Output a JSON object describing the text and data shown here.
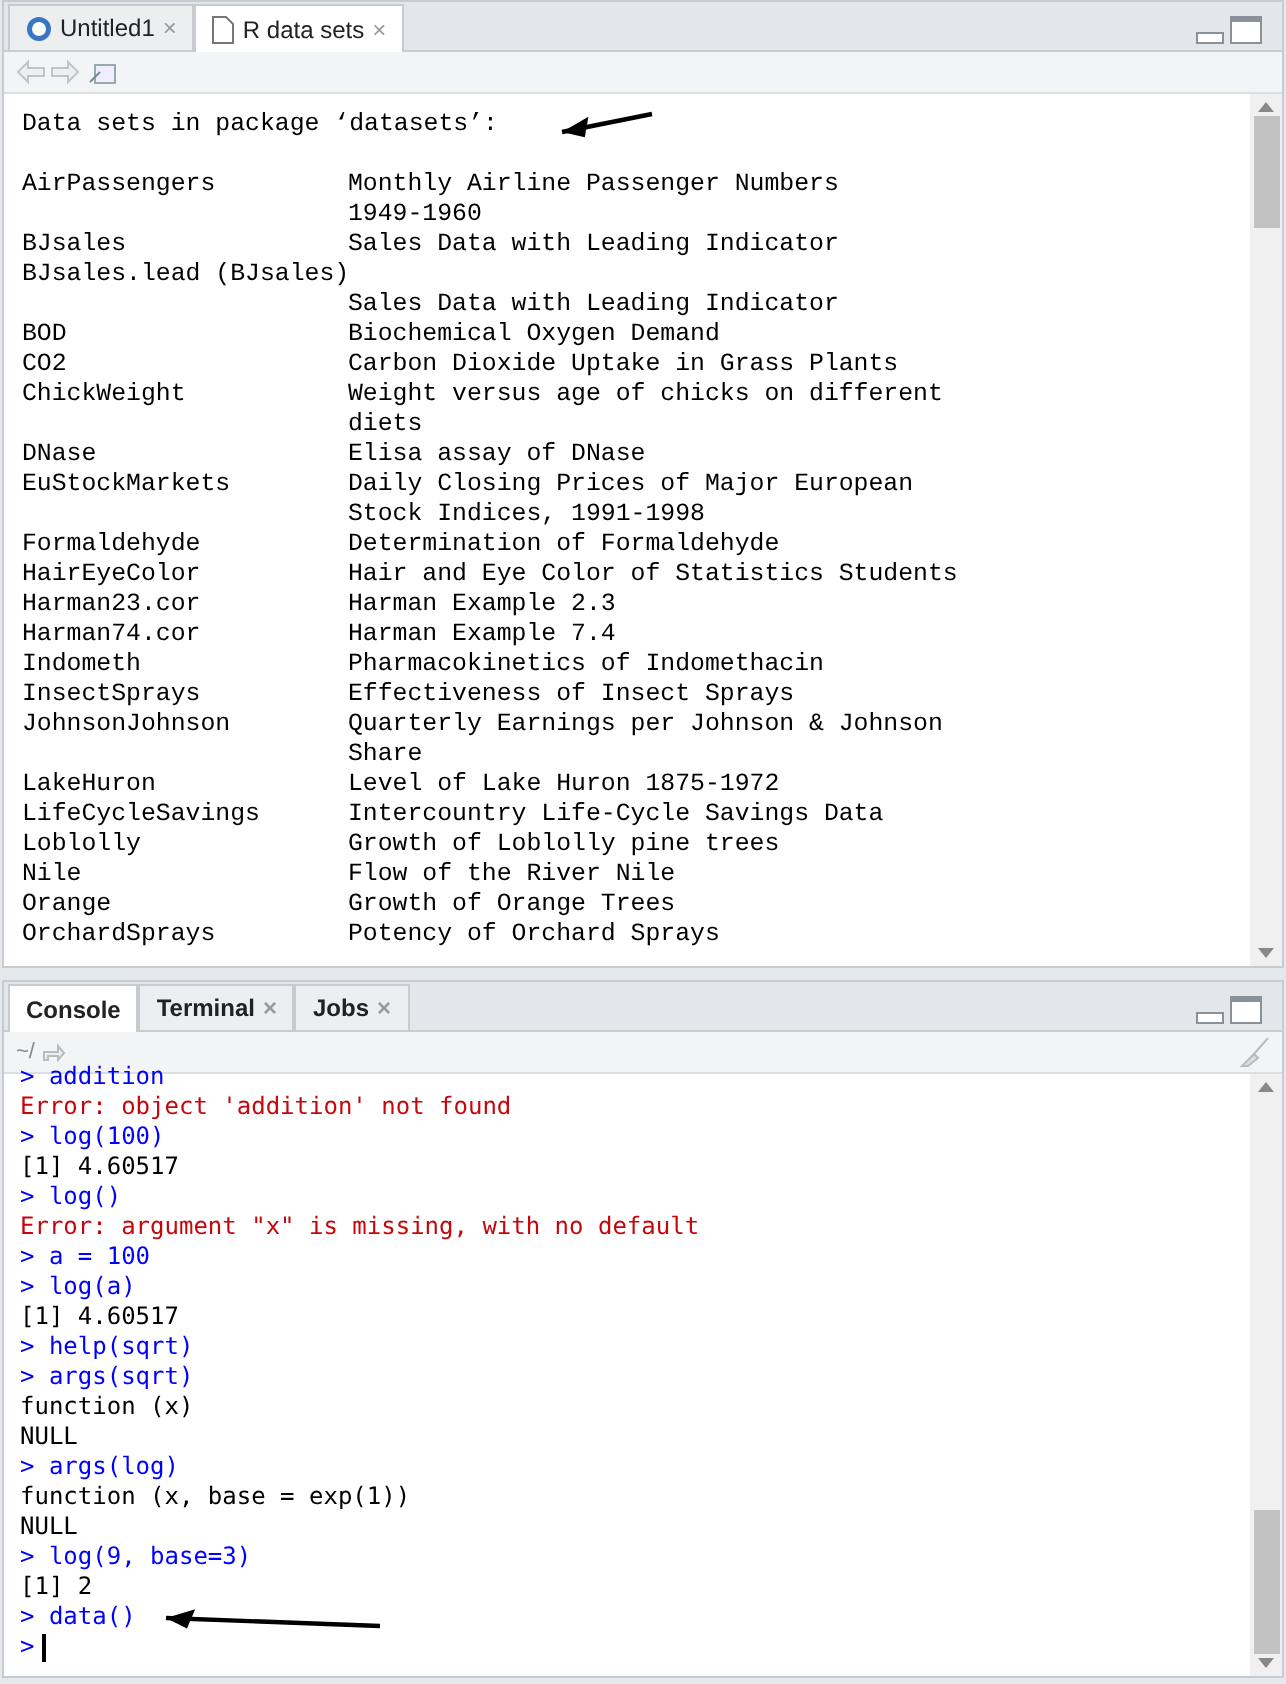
{
  "source_pane": {
    "tabs": [
      {
        "label": "Untitled1",
        "kind": "script",
        "close": "×",
        "selected": false
      },
      {
        "label": "R data sets",
        "kind": "document",
        "close": "×",
        "selected": true
      }
    ],
    "heading": "Data sets in package ‘datasets’:",
    "datasets": [
      {
        "name": "AirPassengers",
        "kind": "inline",
        "description": [
          "Monthly Airline Passenger Numbers",
          "1949-1960"
        ]
      },
      {
        "name": "BJsales",
        "kind": "inline",
        "description": [
          "Sales Data with Leading Indicator"
        ]
      },
      {
        "name": "BJsales.lead (BJsales)",
        "kind": "own_line",
        "description": [
          "Sales Data with Leading Indicator"
        ]
      },
      {
        "name": "BOD",
        "kind": "inline",
        "description": [
          "Biochemical Oxygen Demand"
        ]
      },
      {
        "name": "CO2",
        "kind": "inline",
        "description": [
          "Carbon Dioxide Uptake in Grass Plants"
        ]
      },
      {
        "name": "ChickWeight",
        "kind": "inline",
        "description": [
          "Weight versus age of chicks on different",
          "diets"
        ]
      },
      {
        "name": "DNase",
        "kind": "inline",
        "description": [
          "Elisa assay of DNase"
        ]
      },
      {
        "name": "EuStockMarkets",
        "kind": "inline",
        "description": [
          "Daily Closing Prices of Major European",
          "Stock Indices, 1991-1998"
        ]
      },
      {
        "name": "Formaldehyde",
        "kind": "inline",
        "description": [
          "Determination of Formaldehyde"
        ]
      },
      {
        "name": "HairEyeColor",
        "kind": "inline",
        "description": [
          "Hair and Eye Color of Statistics Students"
        ]
      },
      {
        "name": "Harman23.cor",
        "kind": "inline",
        "description": [
          "Harman Example 2.3"
        ]
      },
      {
        "name": "Harman74.cor",
        "kind": "inline",
        "description": [
          "Harman Example 7.4"
        ]
      },
      {
        "name": "Indometh",
        "kind": "inline",
        "description": [
          "Pharmacokinetics of Indomethacin"
        ]
      },
      {
        "name": "InsectSprays",
        "kind": "inline",
        "description": [
          "Effectiveness of Insect Sprays"
        ]
      },
      {
        "name": "JohnsonJohnson",
        "kind": "inline",
        "description": [
          "Quarterly Earnings per Johnson & Johnson",
          "Share"
        ]
      },
      {
        "name": "LakeHuron",
        "kind": "inline",
        "description": [
          "Level of Lake Huron 1875-1972"
        ]
      },
      {
        "name": "LifeCycleSavings",
        "kind": "inline",
        "description": [
          "Intercountry Life-Cycle Savings Data"
        ]
      },
      {
        "name": "Loblolly",
        "kind": "inline",
        "description": [
          "Growth of Loblolly pine trees"
        ]
      },
      {
        "name": "Nile",
        "kind": "inline",
        "description": [
          "Flow of the River Nile"
        ]
      },
      {
        "name": "Orange",
        "kind": "inline",
        "description": [
          "Growth of Orange Trees"
        ]
      },
      {
        "name": "OrchardSprays",
        "kind": "inline",
        "description": [
          "Potency of Orchard Sprays"
        ]
      }
    ]
  },
  "console_pane": {
    "tabs": [
      {
        "label": "Console",
        "selected": true
      },
      {
        "label": "Terminal",
        "close": "×",
        "selected": false
      },
      {
        "label": "Jobs",
        "close": "×",
        "selected": false
      }
    ],
    "path": "~/",
    "lines": [
      {
        "kind": "input",
        "text": "> addition"
      },
      {
        "kind": "error",
        "text": "Error: object 'addition' not found"
      },
      {
        "kind": "input",
        "text": "> log(100)"
      },
      {
        "kind": "output",
        "text": "[1] 4.60517"
      },
      {
        "kind": "input",
        "text": "> log()"
      },
      {
        "kind": "error",
        "text": "Error: argument \"x\" is missing, with no default"
      },
      {
        "kind": "input",
        "text": "> a = 100"
      },
      {
        "kind": "input",
        "text": "> log(a)"
      },
      {
        "kind": "output",
        "text": "[1] 4.60517"
      },
      {
        "kind": "input",
        "text": "> help(sqrt)"
      },
      {
        "kind": "input",
        "text": "> args(sqrt)"
      },
      {
        "kind": "output",
        "text": "function (x)"
      },
      {
        "kind": "output",
        "text": "NULL"
      },
      {
        "kind": "input",
        "text": "> args(log)"
      },
      {
        "kind": "output",
        "text": "function (x, base = exp(1))"
      },
      {
        "kind": "output",
        "text": "NULL"
      },
      {
        "kind": "input",
        "text": "> log(9, base=3)"
      },
      {
        "kind": "output",
        "text": "[1] 2"
      },
      {
        "kind": "input",
        "text": "> data()"
      },
      {
        "kind": "prompt",
        "text": ">"
      }
    ]
  }
}
